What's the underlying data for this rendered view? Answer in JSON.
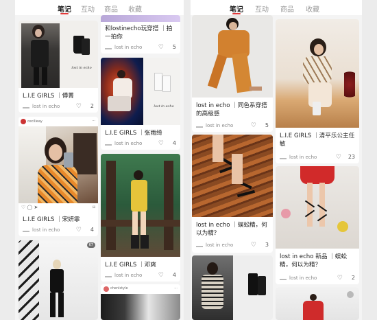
{
  "tabs": [
    "笔记",
    "互动",
    "商品",
    "收藏"
  ],
  "active_tab": "笔记",
  "left_cards": [
    {
      "title": "",
      "author": "",
      "likes": ""
    },
    {
      "title": "和lostinecho玩穿搭 ｜拍一拍你",
      "author": "lost in echo",
      "likes": "5"
    },
    {
      "title": "L.I.E GIRLS ｜傅菁",
      "author": "lost in echo",
      "likes": "2"
    },
    {
      "title": "L.I.E GIRLS ｜张雨绮",
      "author": "lost in echo",
      "likes": "4"
    },
    {
      "title": "L.I.E GIRLS ｜宋妍霏",
      "author": "lost in echo",
      "likes": "4"
    },
    {
      "title": "L.I.E GIRLS ｜邓爽",
      "author": "lost in echo",
      "likes": "4"
    },
    {
      "title": "",
      "author": "",
      "likes": ""
    }
  ],
  "right_cards": [
    {
      "title": "lost in echo ｜同色系穿搭的高级感",
      "author": "lost in echo",
      "likes": "5"
    },
    {
      "title": "L.I.E GIRLS ｜清平乐公主任敏",
      "author": "lost in echo",
      "likes": "23"
    },
    {
      "title": "lost in echo ｜蜈蚣精，何以为精？",
      "author": "lost in echo",
      "likes": "3"
    },
    {
      "title": "lost in echo 新品 ｜蜈蚣精，何以为精？",
      "author": "lost in echo",
      "likes": "2"
    },
    {
      "title": "",
      "author": "",
      "likes": ""
    },
    {
      "title": "",
      "author": "",
      "likes": ""
    }
  ],
  "caption_text": "lost in echo",
  "small_text": {
    "user1": "cecilieay",
    "user2": "chenlstyle",
    "count": "67"
  }
}
